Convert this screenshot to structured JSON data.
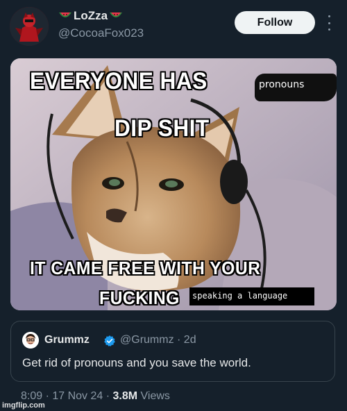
{
  "tweet": {
    "author": {
      "display_name": "LoZza",
      "handle": "@CocoaFox023",
      "name_emoji_icon": "watermelon-icon",
      "avatar_icon": "avatar"
    },
    "follow_label": "Follow",
    "more_icon": "more-options-icon",
    "media": {
      "top_line": "EVERYONE HAS",
      "second_line": "DIP SHIT",
      "third_line": "IT CAME FREE WITH YOUR",
      "fourth_line": "FUCKING",
      "overlay_pronouns": "pronouns",
      "overlay_caption": "speaking a language"
    },
    "quoted": {
      "display_name": "Grummz",
      "handle_time": "@Grummz · 2d",
      "text": "Get rid of pronouns and you save the world.",
      "verified_color": "#1d9bf0"
    },
    "meta": {
      "time_date": "8:09 · 17 Nov 24 · ",
      "views_count": "3.8M",
      "views_label": " Views"
    },
    "watermark": "imgflip.com"
  }
}
